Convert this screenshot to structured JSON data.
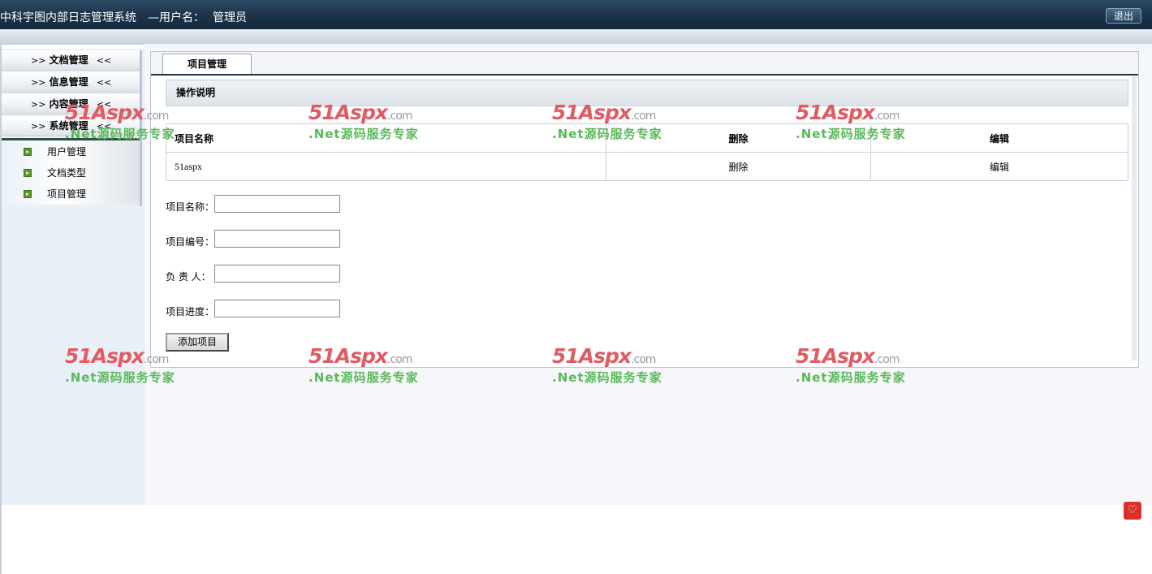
{
  "header": {
    "title": "中科宇图内部日志管理系统",
    "user_prefix": "—用户名：",
    "user_name": "管理员",
    "logout_label": "退出"
  },
  "sidebar": {
    "menus": [
      {
        "left": ">>",
        "label": "文档管理",
        "right": "<<"
      },
      {
        "left": ">>",
        "label": "信息管理",
        "right": "<<"
      },
      {
        "left": ">>",
        "label": "内容管理",
        "right": "<<"
      },
      {
        "left": ">>",
        "label": "系统管理",
        "right": "<<"
      }
    ],
    "sub_items": [
      {
        "label": "用户管理",
        "icon": "arrow-bullet-icon"
      },
      {
        "label": "文档类型",
        "icon": "arrow-bullet-icon"
      },
      {
        "label": "项目管理",
        "icon": "arrow-bullet-icon"
      }
    ]
  },
  "main": {
    "tab_label": "项目管理",
    "instructions_title": "操作说明",
    "table": {
      "headers": [
        "项目名称",
        "删除",
        "编辑"
      ],
      "rows": [
        [
          "51aspx",
          "删除",
          "编辑"
        ]
      ]
    },
    "form": {
      "fields": [
        {
          "label": "项目名称：",
          "value": ""
        },
        {
          "label": "项目编号：",
          "value": ""
        },
        {
          "label": "负 责 人：",
          "value": ""
        },
        {
          "label": "项目进度：",
          "value": ""
        }
      ],
      "submit_label": "添加项目"
    }
  },
  "watermark": {
    "brand": "51Aspx",
    "domain": ".com",
    "slogan": ".Net源码服务专家"
  },
  "colors": {
    "header_bg": "#1c3349",
    "sidebar_bg": "#eaf0f8",
    "watermark_red": "#e05b62",
    "watermark_green": "#5cb85c"
  }
}
